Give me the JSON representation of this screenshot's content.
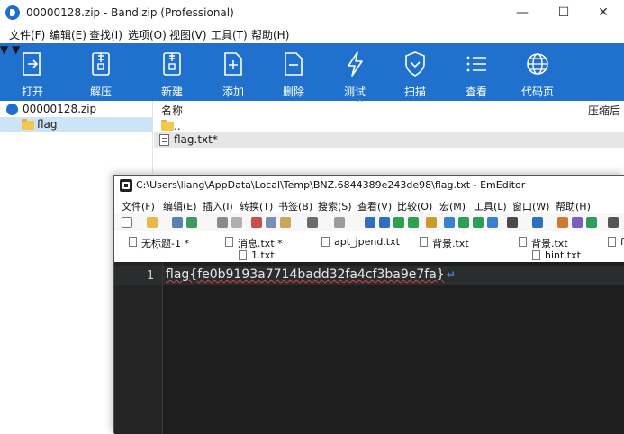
{
  "bandizip": {
    "title": "00000128.zip - Bandizip (Professional)",
    "window_controls": {
      "minimize": "—",
      "maximize": "☐",
      "close": "✕"
    },
    "menu": [
      "文件(F)",
      "编辑(E)",
      "查找(I)",
      "选项(O)",
      "视图(V)",
      "工具(T)",
      "帮助(H)"
    ],
    "toolbar": {
      "open": "打开",
      "extract": "解压",
      "new": "新建",
      "add": "添加",
      "delete": "删除",
      "test": "测试",
      "scan": "扫描",
      "view": "查看",
      "codepage": "代码页"
    },
    "tree": {
      "archive": "00000128.zip",
      "folder": "flag"
    },
    "list": {
      "col_name": "名称",
      "col_ratio": "压缩后",
      "parent": "..",
      "file": "flag.txt*"
    }
  },
  "emeditor": {
    "title": "C:\\Users\\liang\\AppData\\Local\\Temp\\BNZ.6844389e243de98\\flag.txt - EmEditor",
    "menu": [
      "文件(F)",
      "编辑(E)",
      "插入(I)",
      "转换(T)",
      "书签(B)",
      "搜索(S)",
      "查看(V)",
      "比较(O)",
      "宏(M)",
      "工具(L)",
      "窗口(W)",
      "帮助(H)"
    ],
    "tabs_row1": [
      "无标题-1 *",
      "消息.txt *",
      "apt_jpend.txt",
      "背景.txt",
      "背景.txt",
      "fl"
    ],
    "tabs_row2": [
      "1.txt",
      "hint.txt"
    ],
    "line_number": "1",
    "content": "flag{fe0b9193a7714badd32fa4cf3ba9e7fa}",
    "eol_mark": "↵"
  }
}
